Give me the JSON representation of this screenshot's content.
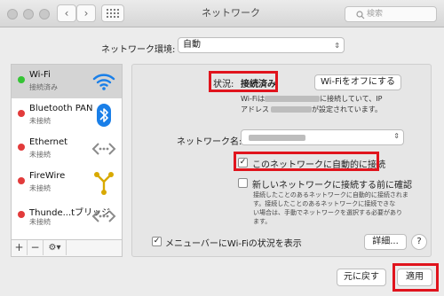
{
  "window": {
    "title": "ネットワーク",
    "search_placeholder": "検索",
    "grid_icon": "grid-icon"
  },
  "location": {
    "label": "ネットワーク環境:",
    "value": "自動"
  },
  "services": [
    {
      "name": "Wi-Fi",
      "status": "接続済み",
      "dot": "#35c435",
      "icon": "wifi-icon"
    },
    {
      "name": "Bluetooth PAN",
      "status": "未接続",
      "dot": "#e23b3b",
      "icon": "bluetooth-icon"
    },
    {
      "name": "Ethernet",
      "status": "未接続",
      "dot": "#e23b3b",
      "icon": "ethernet-icon"
    },
    {
      "name": "FireWire",
      "status": "未接続",
      "dot": "#e23b3b",
      "icon": "firewire-icon"
    },
    {
      "name": "Thunde...tブリッジ",
      "status": "未接続",
      "dot": "#e23b3b",
      "icon": "thunderbolt-icon"
    }
  ],
  "sidebar_buttons": {
    "add": "+",
    "remove": "−",
    "gear": "gear-icon"
  },
  "detail": {
    "status_label": "状況:",
    "status_value": "接続済み",
    "wifi_off_button": "Wi-Fiをオフにする",
    "desc_line1_a": "Wi-Fiは",
    "desc_line1_b": "に接続していて、IP",
    "desc_line2_a": "アドレス",
    "desc_line2_b": "が設定されています。",
    "network_name_label": "ネットワーク名:",
    "auto_join_label": "このネットワークに自動的に接続",
    "ask_join_label": "新しいネットワークに接続する前に確認",
    "ask_desc_1": "接続したことのあるネットワークに自動的に接続されま",
    "ask_desc_2": "す。接続したことのあるネットワークに接続できな",
    "ask_desc_3": "い場合は、手動でネットワークを選択する必要があり",
    "ask_desc_4": "ます。",
    "menubar_label": "メニューバーにWi-Fiの状況を表示",
    "advanced_button": "詳細...",
    "help_button": "?"
  },
  "footer": {
    "revert_button": "元に戻す",
    "apply_button": "適用"
  },
  "colors": {
    "highlight": "#e0141d",
    "wifi_icon": "#1a7fe8",
    "bluetooth_bg": "#1a7fe8"
  }
}
